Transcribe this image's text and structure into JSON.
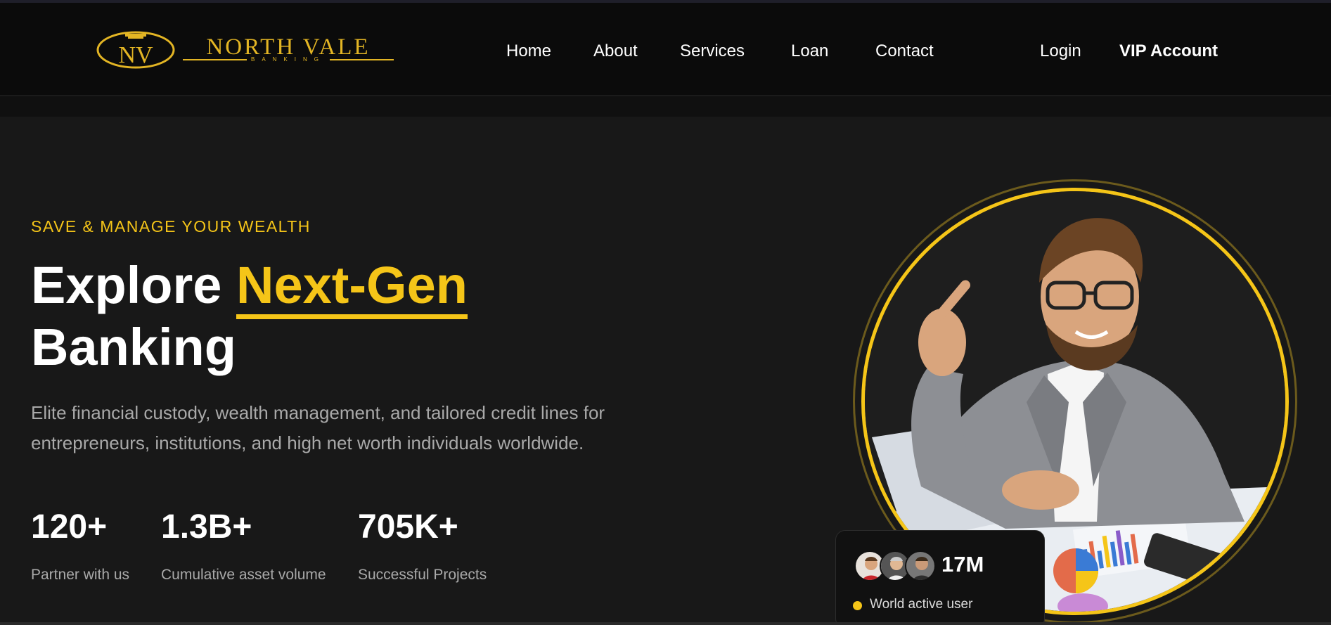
{
  "brand": {
    "name": "NORTH VALE",
    "subtitle": "BANKING",
    "emblem_letters": "NV",
    "accent_color": "#f5c518",
    "logo_color": "#e3b524"
  },
  "nav": {
    "items": [
      {
        "label": "Home"
      },
      {
        "label": "About"
      },
      {
        "label": "Services"
      },
      {
        "label": "Loan"
      },
      {
        "label": "Contact"
      }
    ],
    "login_label": "Login",
    "vip_label": "VIP Account"
  },
  "hero": {
    "eyebrow": "SAVE & MANAGE YOUR WEALTH",
    "title_prefix": "Explore",
    "title_highlight": "Next-Gen",
    "title_suffix": "Banking",
    "description": "Elite financial custody, wealth management, and tailored credit lines for entrepreneurs, institutions, and high net worth individuals worldwide.",
    "stats": [
      {
        "value": "120+",
        "label": "Partner with us"
      },
      {
        "value": "1.3B+",
        "label": "Cumulative asset volume"
      },
      {
        "value": "705K+",
        "label": "Successful Projects"
      }
    ]
  },
  "users_card": {
    "count": "17M",
    "label": "World active user",
    "avatars": [
      "avatar-red-shirt",
      "avatar-white-shirt",
      "avatar-dark-suit"
    ]
  }
}
